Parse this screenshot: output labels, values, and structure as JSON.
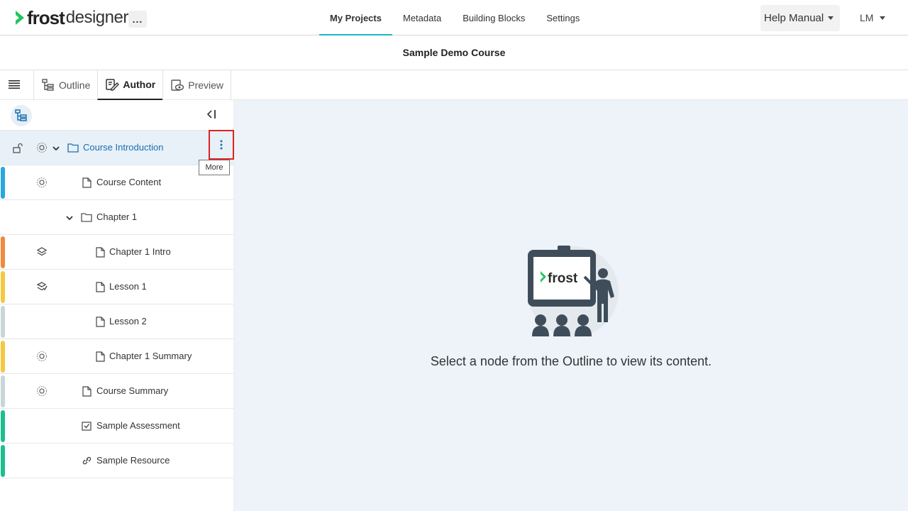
{
  "app": {
    "logo_frost": "frost",
    "logo_designer": "designer",
    "more_dots": "..."
  },
  "nav": {
    "items": [
      {
        "label": "My Projects",
        "active": true
      },
      {
        "label": "Metadata",
        "active": false
      },
      {
        "label": "Building Blocks",
        "active": false
      },
      {
        "label": "Settings",
        "active": false
      }
    ],
    "help_label": "Help Manual",
    "user_initials": "LM"
  },
  "course": {
    "title": "Sample Demo Course"
  },
  "tabs": {
    "outline": "Outline",
    "author": "Author",
    "preview": "Preview",
    "active": "Author"
  },
  "tree": {
    "items": [
      {
        "label": "Course Introduction",
        "type": "folder",
        "strip": "",
        "status": "gear"
      },
      {
        "label": "Course Content",
        "type": "page",
        "strip": "#29a8e0",
        "status": "gear"
      },
      {
        "label": "Chapter 1",
        "type": "folder",
        "strip": "",
        "status": ""
      },
      {
        "label": "Chapter 1 Intro",
        "type": "page",
        "strip": "#f08a3c",
        "status": "layers"
      },
      {
        "label": "Lesson 1",
        "type": "page",
        "strip": "#f5c842",
        "status": "layers-check"
      },
      {
        "label": "Lesson 2",
        "type": "page",
        "strip": "#c9d6d9",
        "status": ""
      },
      {
        "label": "Chapter 1 Summary",
        "type": "page",
        "strip": "#f5c842",
        "status": "gear"
      },
      {
        "label": "Course Summary",
        "type": "page",
        "strip": "#c9d6d9",
        "status": "gear"
      },
      {
        "label": "Sample Assessment",
        "type": "assessment",
        "strip": "#1cbf8f",
        "status": ""
      },
      {
        "label": "Sample Resource",
        "type": "resource",
        "strip": "#1cbf8f",
        "status": ""
      }
    ],
    "more_tooltip": "More"
  },
  "main": {
    "illustration_text": "frost",
    "empty_message": "Select a node from the Outline to view its content."
  },
  "colors": {
    "accent": "#1ab6c8",
    "brand_green": "#22c55e",
    "selected_text": "#1a6fb0",
    "main_bg": "#eef3f9"
  }
}
